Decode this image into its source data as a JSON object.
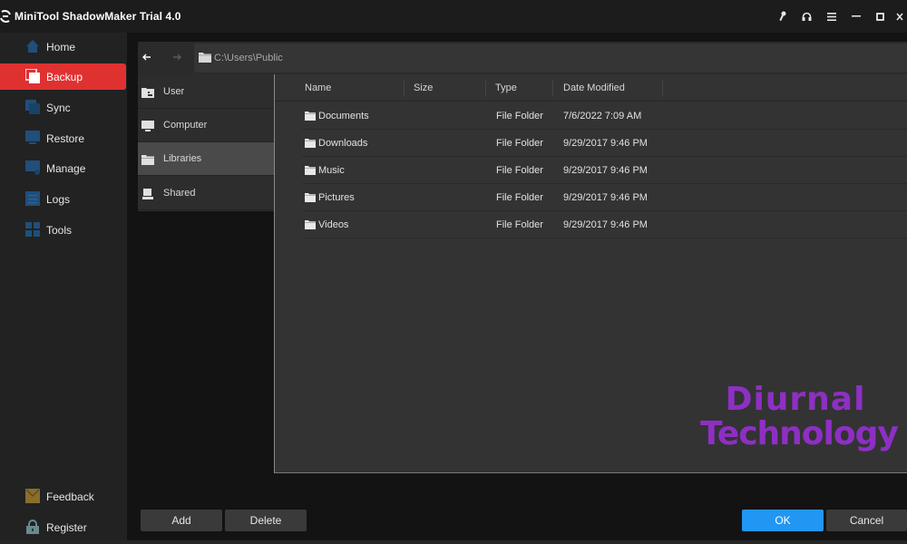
{
  "app": {
    "title": "MiniTool ShadowMaker Trial 4.0",
    "window_controls": [
      {
        "icon": "key-icon",
        "glyph": "🔑"
      },
      {
        "icon": "headset-icon",
        "glyph": "🎧"
      },
      {
        "icon": "menu-icon",
        "glyph": "≡"
      },
      {
        "icon": "minimize-icon",
        "glyph": "—"
      },
      {
        "icon": "maximize-icon",
        "glyph": "□"
      },
      {
        "icon": "close-icon",
        "glyph": "✕"
      }
    ]
  },
  "sidebar": {
    "items": [
      {
        "label": "Home",
        "icon": "home-icon",
        "active": false
      },
      {
        "label": "Backup",
        "icon": "backup-icon",
        "active": true
      },
      {
        "label": "Sync",
        "icon": "sync-icon",
        "active": false
      },
      {
        "label": "Restore",
        "icon": "restore-icon",
        "active": false
      },
      {
        "label": "Manage",
        "icon": "manage-icon",
        "active": false
      },
      {
        "label": "Logs",
        "icon": "logs-icon",
        "active": false
      },
      {
        "label": "Tools",
        "icon": "tools-icon",
        "active": false
      }
    ],
    "bottom": [
      {
        "label": "Feedback",
        "icon": "feedback-icon"
      },
      {
        "label": "Register",
        "icon": "lock-icon"
      }
    ],
    "accent_color": "#e03131",
    "icon_color": "#1f4f7a"
  },
  "browser": {
    "back_glyph": "←",
    "forward_glyph": "→",
    "path": "C:\\Users\\Public",
    "locations": [
      {
        "label": "User",
        "icon": "user-folder-icon",
        "active": false
      },
      {
        "label": "Computer",
        "icon": "computer-icon",
        "active": false
      },
      {
        "label": "Libraries",
        "icon": "folder-icon",
        "active": true
      },
      {
        "label": "Shared",
        "icon": "shared-icon",
        "active": false
      }
    ],
    "columns": [
      "Name",
      "Size",
      "Type",
      "Date Modified"
    ],
    "files": [
      {
        "name": "Documents",
        "size": "",
        "type": "File Folder",
        "date": "7/6/2022 7:09 AM"
      },
      {
        "name": "Downloads",
        "size": "",
        "type": "File Folder",
        "date": "9/29/2017 9:46 PM"
      },
      {
        "name": "Music",
        "size": "",
        "type": "File Folder",
        "date": "9/29/2017 9:46 PM"
      },
      {
        "name": "Pictures",
        "size": "",
        "type": "File Folder",
        "date": "9/29/2017 9:46 PM"
      },
      {
        "name": "Videos",
        "size": "",
        "type": "File Folder",
        "date": "9/29/2017 9:46 PM"
      }
    ]
  },
  "watermark": {
    "line1": "Diurnal",
    "line2": "Technology",
    "color": "#8e2fc4"
  },
  "buttons": {
    "add": "Add",
    "delete": "Delete",
    "ok": "OK",
    "cancel": "Cancel",
    "ok_color": "#2196f3"
  }
}
